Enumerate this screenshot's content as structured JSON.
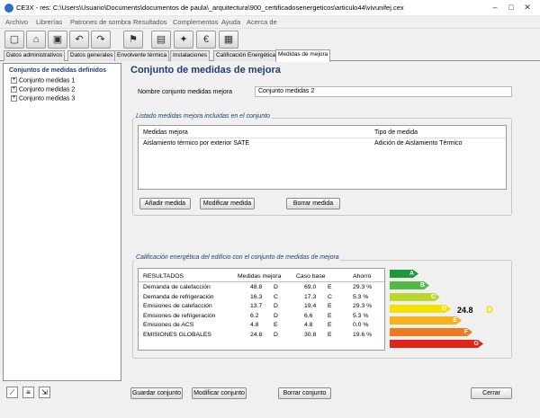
{
  "window": {
    "title": "CE3X - res: C:\\Users\\Usuario\\Documents\\documentos de paula\\_arquitectura\\900_certificadosenergeticos\\articulo44\\vivunifej.cex"
  },
  "menu": [
    "Archivo",
    "Librerías",
    "Patrones de sombra",
    "Resultados",
    "Complementos",
    "Ayuda",
    "Acerca de"
  ],
  "toolbar": [
    {
      "icon": "new-document-icon",
      "glyph": "▢"
    },
    {
      "icon": "open-folder-icon",
      "glyph": "⌂"
    },
    {
      "icon": "save-icon",
      "glyph": "▣"
    },
    {
      "icon": "undo-icon",
      "glyph": "↶"
    },
    {
      "icon": "redo-icon",
      "glyph": "↷"
    },
    {
      "icon": "building-flag-icon",
      "glyph": "⚑"
    },
    {
      "icon": "stairs-building-icon",
      "glyph": "▤"
    },
    {
      "icon": "magic-wand-icon",
      "glyph": "✦"
    },
    {
      "icon": "euro-icon",
      "glyph": "€"
    },
    {
      "icon": "notes-icon",
      "glyph": "▦"
    }
  ],
  "tabs": [
    "Datos administrativos",
    "Datos generales",
    "Envolvente térmica",
    "Instalaciones",
    "Calificación Energética",
    "Medidas de mejora"
  ],
  "active_tab": "Medidas de mejora",
  "tree": {
    "root": "Conjuntos de medidas definidos",
    "items": [
      "Conjunto medidas 1",
      "Conjunto medidas 2",
      "Conjunto medidas 3"
    ]
  },
  "main": {
    "title": "Conjunto de medidas de mejora",
    "name_label": "Nombre conjunto medidas mejora",
    "name_value": "Conjunto medidas 2",
    "list_group_title": "Listado medidas mejora incluidas en el conjunto",
    "list_headers": [
      "Medidas mejora",
      "Tipo de medida"
    ],
    "list_rows": [
      [
        "Aislamiento térmico por exterior SATE",
        "Adición de Aislamiento Térmico"
      ]
    ],
    "buttons": {
      "add": "Añadir medida",
      "modify": "Modificar medida",
      "delete": "Borrar medida"
    },
    "rating_group_title": "Calificación energética del edificio con el conjunto de medidas de mejora"
  },
  "results": {
    "headers": [
      "RESULTADOS",
      "Medidas mejora",
      "Caso base",
      "Ahorro"
    ],
    "rows": [
      {
        "label": "Demanda de calefacción",
        "mejora": "48.8",
        "mejora_grade": "D",
        "base": "69.0",
        "base_grade": "E",
        "ahorro": "29.3 %"
      },
      {
        "label": "Demanda de refrigeración",
        "mejora": "16.3",
        "mejora_grade": "C",
        "base": "17.3",
        "base_grade": "C",
        "ahorro": "5.3 %"
      },
      {
        "label": "Emisiones de calefacción",
        "mejora": "13.7",
        "mejora_grade": "D",
        "base": "19.4",
        "base_grade": "E",
        "ahorro": "29.3 %"
      },
      {
        "label": "Emisiones de refrigeración",
        "mejora": "6.2",
        "mejora_grade": "D",
        "base": "6.6",
        "base_grade": "E",
        "ahorro": "5.3 %"
      },
      {
        "label": "Emisiones de ACS",
        "mejora": "4.8",
        "mejora_grade": "E",
        "base": "4.8",
        "base_grade": "E",
        "ahorro": "0.0 %"
      },
      {
        "label": "EMISIONES GLOBALES",
        "mejora": "24.8",
        "mejora_grade": "D",
        "base": "30.8",
        "base_grade": "E",
        "ahorro": "19.6 %"
      }
    ]
  },
  "rating": {
    "scale": [
      {
        "letter": "A",
        "color": "#1b9a3a"
      },
      {
        "letter": "B",
        "color": "#52b947"
      },
      {
        "letter": "C",
        "color": "#bcd630"
      },
      {
        "letter": "D",
        "color": "#f3e100"
      },
      {
        "letter": "E",
        "color": "#f6b21a"
      },
      {
        "letter": "F",
        "color": "#ee7a1d"
      },
      {
        "letter": "G",
        "color": "#e2231a"
      }
    ],
    "value": "24.8",
    "letter": "D"
  },
  "footer": {
    "save": "Guardar conjunto",
    "modify": "Modificar conjunto",
    "delete": "Borrar conjunto",
    "close": "Cerrar",
    "icons": [
      "wand-tool-icon",
      "list-tool-icon",
      "resize-tool-icon"
    ]
  }
}
